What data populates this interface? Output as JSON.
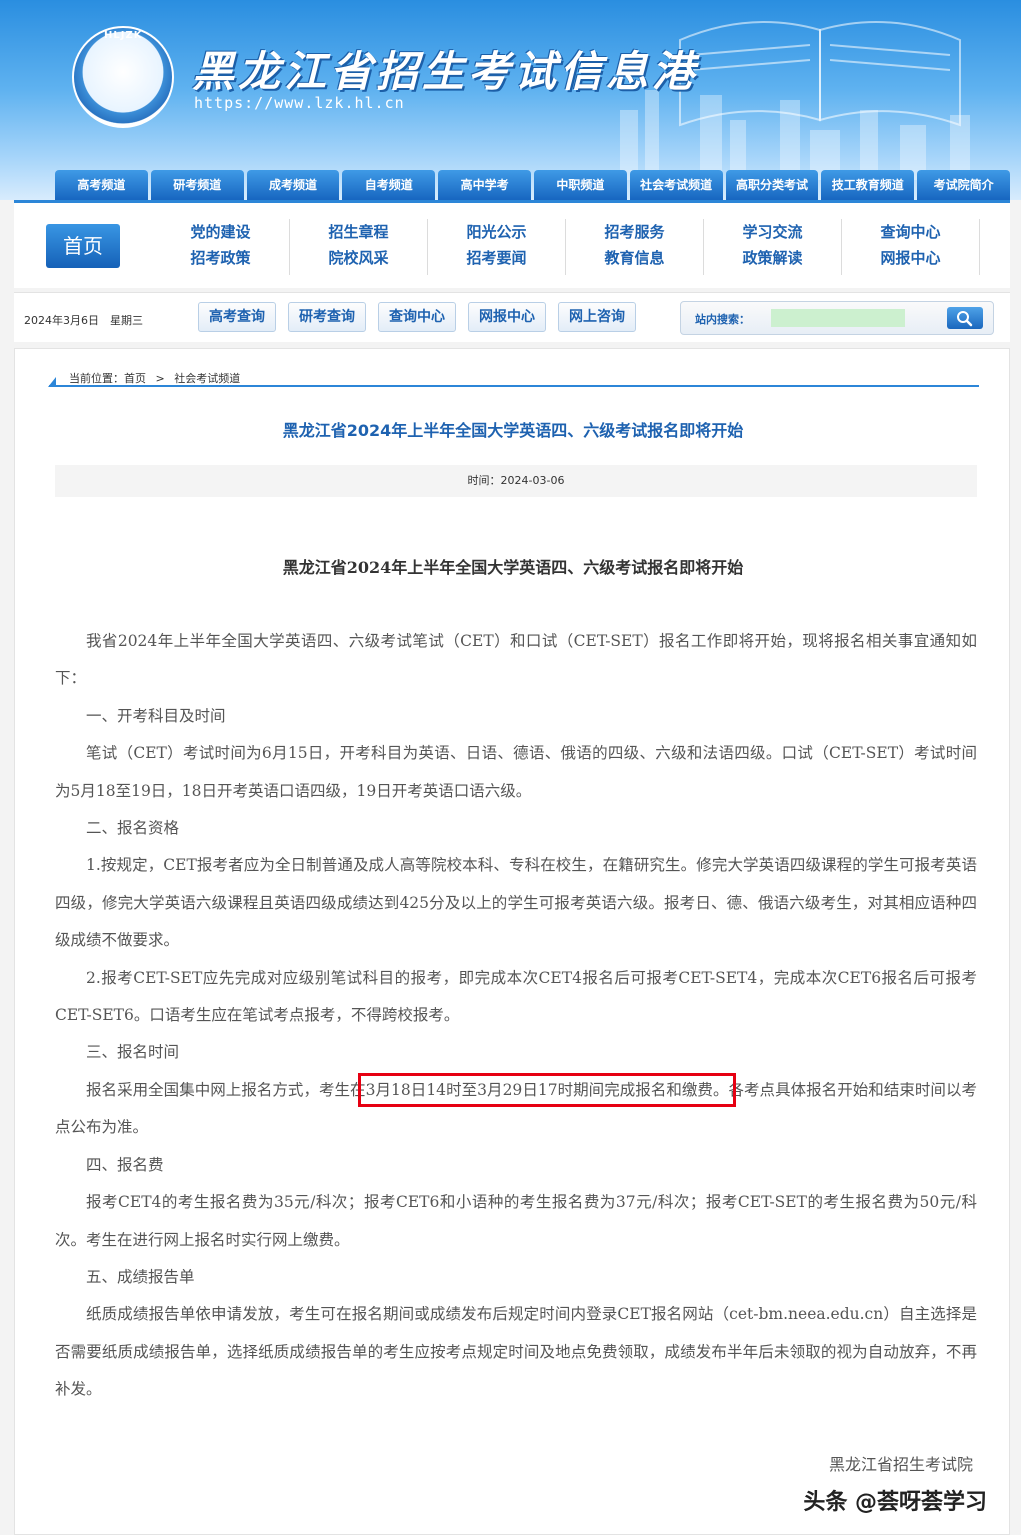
{
  "header": {
    "logo_text": "HLJZK",
    "site_title": "黑龙江省招生考试信息港",
    "site_url": "https://www.lzk.hl.cn",
    "channels": [
      "高考频道",
      "研考频道",
      "成考频道",
      "自考频道",
      "高中学考",
      "中职频道",
      "社会考试频道",
      "高职分类考试",
      "技工教育频道",
      "考试院简介"
    ]
  },
  "nav": {
    "home": "首页",
    "columns": [
      [
        "党的建设",
        "招考政策"
      ],
      [
        "招生章程",
        "院校风采"
      ],
      [
        "阳光公示",
        "招考要闻"
      ],
      [
        "招考服务",
        "教育信息"
      ],
      [
        "学习交流",
        "政策解读"
      ],
      [
        "查询中心",
        "网报中心"
      ]
    ]
  },
  "query_bar": {
    "date": "2024年3月6日　星期三",
    "buttons": [
      "高考查询",
      "研考查询",
      "查询中心",
      "网报中心",
      "网上咨询"
    ],
    "search_label": "站内搜索：",
    "search_value": ""
  },
  "article": {
    "breadcrumb": [
      "当前位置：首页",
      ">",
      "社会考试频道"
    ],
    "title": "黑龙江省2024年上半年全国大学英语四、六级考试报名即将开始",
    "time": "时间：2024-03-06",
    "doc_title": "黑龙江省2024年上半年全国大学英语四、六级考试报名即将开始",
    "p1": "我省2024年上半年全国大学英语四、六级考试笔试（CET）和口试（CET-SET）报名工作即将开始，现将报名相关事宜通知如下：",
    "h1": "一、开考科目及时间",
    "p2": "笔试（CET）考试时间为6月15日，开考科目为英语、日语、德语、俄语的四级、六级和法语四级。口试（CET-SET）考试时间为5月18至19日，18日开考英语口语四级，19日开考英语口语六级。",
    "h2": "二、报名资格",
    "p3": "1.按规定，CET报考者应为全日制普通及成人高等院校本科、专科在校生，在籍研究生。修完大学英语四级课程的学生可报考英语四级，修完大学英语六级课程且英语四级成绩达到425分及以上的学生可报考英语六级。报考日、德、俄语六级考生，对其相应语种四级成绩不做要求。",
    "p4": "2.报考CET-SET应先完成对应级别笔试科目的报考，即完成本次CET4报名后可报考CET-SET4，完成本次CET6报名后可报考CET-SET6。口语考生应在笔试考点报考，不得跨校报考。",
    "h3": "三、报名时间",
    "p5_a": "报名采用全国集中网上报名方式，考生在",
    "p5_hl": "3月18日14时至3月29日17时期间完成报名和缴费。",
    "p5_b": "各考点具体报名开始和结束时间以考点公布为准。",
    "h4": "四、报名费",
    "p6": "报考CET4的考生报名费为35元/科次；报考CET6和小语种的考生报名费为37元/科次；报考CET-SET的考生报名费为50元/科次。考生在进行网上报名时实行网上缴费。",
    "h5": "五、成绩报告单",
    "p7": "纸质成绩报告单依申请发放，考生可在报名期间或成绩发布后规定时间内登录CET报名网站（cet-bm.neea.edu.cn）自主选择是否需要纸质成绩报告单，选择纸质成绩报告单的考生应按考点规定时间及地点免费领取，成绩发布半年后未领取的视为自动放弃，不再补发。",
    "signature": "黑龙江省招生考试院"
  },
  "watermark": "头条 @荟呀荟学习",
  "colors": {
    "brand_blue": "#2c86d8",
    "link_blue": "#1e62b0",
    "highlight_red": "#e60012"
  }
}
